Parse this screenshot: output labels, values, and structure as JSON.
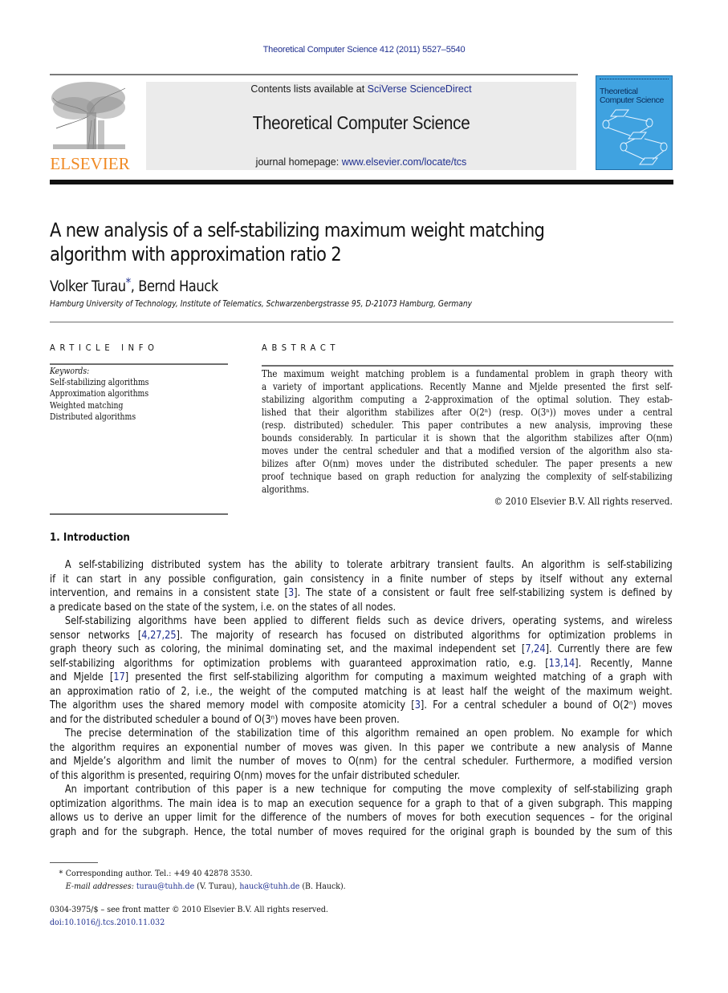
{
  "journal_ref": "Theoretical Computer Science 412 (2011) 5527–5540",
  "header": {
    "publisher_logo_text": "ELSEVIER",
    "contents_prefix": "Contents lists available at ",
    "contents_link": "SciVerse ScienceDirect",
    "journal_title": "Theoretical Computer Science",
    "homepage_prefix": "journal homepage: ",
    "homepage_link": "www.elsevier.com/locate/tcs",
    "cover_title_line1": "Theoretical",
    "cover_title_line2": "Computer Science",
    "cover_color": "#3fa2e0",
    "logo_color": "#f08a24",
    "link_color": "#1f2f8f"
  },
  "article": {
    "title_line1": "A new analysis of a self-stabilizing maximum weight matching",
    "title_line2": "algorithm with approximation ratio 2",
    "author1": "Volker Turau",
    "author_marker": "*",
    "author_sep": ", ",
    "author2": "Bernd Hauck",
    "affiliation": "Hamburg University of Technology, Institute of Telematics, Schwarzenbergstrasse 95, D-21073 Hamburg, Germany"
  },
  "article_info": {
    "heading": "ARTICLE INFO",
    "keywords_label": "Keywords:",
    "keywords": [
      "Self-stabilizing algorithms",
      "Approximation algorithms",
      "Weighted matching",
      "Distributed algorithms"
    ]
  },
  "abstract": {
    "heading": "ABSTRACT",
    "lines": [
      "The maximum weight matching problem is a fundamental problem in graph theory with",
      "a variety of important applications. Recently Manne and Mjelde presented the first self-",
      "stabilizing algorithm computing a 2-approximation of the optimal solution. They estab-",
      "lished that their algorithm stabilizes after O(2ⁿ) (resp. O(3ⁿ)) moves under a central",
      "(resp. distributed) scheduler. This paper contributes a new analysis, improving these",
      "bounds considerably. In particular it is shown that the algorithm stabilizes after O(nm)",
      "moves under the central scheduler and that a modified version of the algorithm also sta-",
      "bilizes after O(nm) moves under the distributed scheduler. The paper presents a new",
      "proof technique based on graph reduction for analyzing the complexity of self-stabilizing",
      "algorithms."
    ],
    "copyright": "© 2010 Elsevier B.V. All rights reserved."
  },
  "introduction": {
    "heading": "1.  Introduction",
    "lines": [
      {
        "indent": true,
        "text": "A self-stabilizing distributed system has the ability to tolerate arbitrary transient faults. An algorithm is self-stabilizing"
      },
      {
        "indent": false,
        "text": "if it can start in any possible configuration, gain consistency in a finite number of steps by itself without any external"
      },
      {
        "indent": false,
        "text": "intervention, and remains in a consistent state [3]. The state of a consistent or fault free self-stabilizing system is defined by"
      },
      {
        "indent": false,
        "last": true,
        "text": "a predicate based on the state of the system, i.e. on the states of all nodes."
      },
      {
        "indent": true,
        "text": "Self-stabilizing algorithms have been applied to different fields such as device drivers, operating systems, and wireless"
      },
      {
        "indent": false,
        "text": "sensor networks [4,27,25]. The majority of research has focused on distributed algorithms for optimization problems in"
      },
      {
        "indent": false,
        "text": "graph theory such as coloring, the minimal dominating set, and the maximal independent set [7,24]. Currently there are few"
      },
      {
        "indent": false,
        "text": "self-stabilizing algorithms for optimization problems with guaranteed approximation ratio, e.g. [13,14]. Recently, Manne"
      },
      {
        "indent": false,
        "text": "and Mjelde [17] presented the first self-stabilizing algorithm for computing a maximum weighted matching of a graph with"
      },
      {
        "indent": false,
        "text": "an approximation ratio of 2, i.e., the weight of the computed matching is at least half the weight of the maximum weight."
      },
      {
        "indent": false,
        "text": "The algorithm uses the shared memory model with composite atomicity [3]. For a central scheduler a bound of O(2ⁿ) moves"
      },
      {
        "indent": false,
        "last": true,
        "text": "and for the distributed scheduler a bound of O(3ⁿ) moves have been proven."
      },
      {
        "indent": true,
        "text": "The precise determination of the stabilization time of this algorithm remained an open problem. No example for which"
      },
      {
        "indent": false,
        "text": "the algorithm requires an exponential number of moves was given. In this paper we contribute a new analysis of Manne"
      },
      {
        "indent": false,
        "text": "and Mjelde’s algorithm and limit the number of moves to O(nm) for the central scheduler. Furthermore, a modified version"
      },
      {
        "indent": false,
        "last": true,
        "text": "of this algorithm is presented, requiring O(nm) moves for the unfair distributed scheduler."
      },
      {
        "indent": true,
        "text": "An important contribution of this paper is a new technique for computing the move complexity of self-stabilizing graph"
      },
      {
        "indent": false,
        "text": "optimization algorithms. The main idea is to map an execution sequence for a graph to that of a given subgraph. This mapping"
      },
      {
        "indent": false,
        "text": "allows us to derive an upper limit for the difference of the numbers of moves for both execution sequences – for the original"
      },
      {
        "indent": false,
        "text": "graph and for the subgraph. Hence, the total number of moves required for the original graph is bounded by the sum of this"
      }
    ]
  },
  "footnotes": {
    "marker": "*",
    "corresponding": "Corresponding author. Tel.: +49 40 42878 3530.",
    "email_label": "E-mail addresses: ",
    "email1": "turau@tuhh.de",
    "email1_name": " (V. Turau), ",
    "email2": "hauck@tuhh.de",
    "email2_name": " (B. Hauck).",
    "issn": "0304-3975/$ – see front matter © 2010 Elsevier B.V. All rights reserved.",
    "doi": "doi:10.1016/j.tcs.2010.11.032"
  }
}
